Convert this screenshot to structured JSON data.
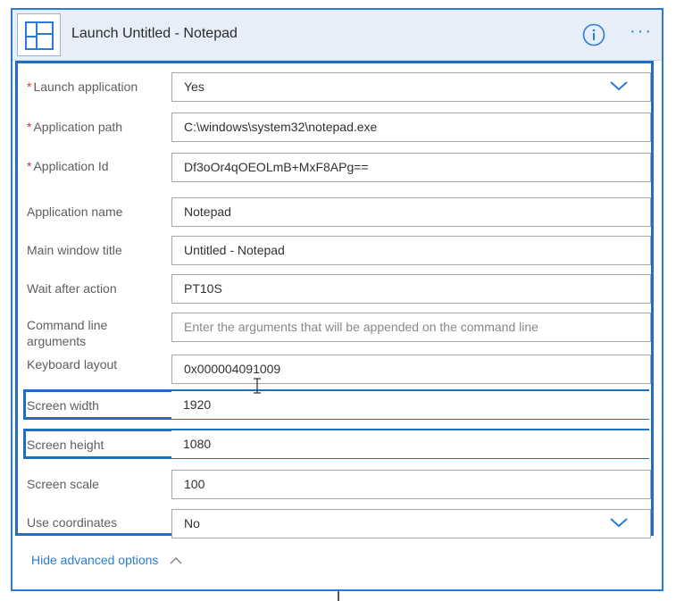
{
  "header": {
    "title": "Launch Untitled - Notepad",
    "info_icon": "info-icon",
    "more_icon": "more-icon",
    "more_label": "···"
  },
  "params": {
    "launch_application": {
      "label": "Launch application",
      "required": "*",
      "value": "Yes"
    },
    "application_path": {
      "label": "Application path",
      "required": "*",
      "value": "C:\\windows\\system32\\notepad.exe"
    },
    "application_id": {
      "label": "Application Id",
      "required": "*",
      "value": "Df3oOr4qOEOLmB+MxF8APg=="
    },
    "application_name": {
      "label": "Application name",
      "value": "Notepad"
    },
    "main_window_title": {
      "label": "Main window title",
      "value": "Untitled - Notepad"
    },
    "wait_after_action": {
      "label": "Wait after action",
      "value": "PT10S"
    },
    "command_line_arguments": {
      "label": "Command line arguments",
      "placeholder": "Enter the arguments that will be appended on the command line"
    },
    "keyboard_layout": {
      "label": "Keyboard layout",
      "value": "0x000004091009"
    },
    "screen_width": {
      "label": "Screen width",
      "value": "1920"
    },
    "screen_height": {
      "label": "Screen height",
      "value": "1080"
    },
    "screen_scale": {
      "label": "Screen scale",
      "value": "100"
    },
    "use_coordinates": {
      "label": "Use coordinates",
      "value": "No"
    }
  },
  "footer": {
    "hide_advanced_label": "Hide advanced options"
  },
  "colors": {
    "accent": "#2b7bd6",
    "highlight_border": "#1f6fc0",
    "header_bg": "#e6eef9",
    "required": "#d13438"
  }
}
